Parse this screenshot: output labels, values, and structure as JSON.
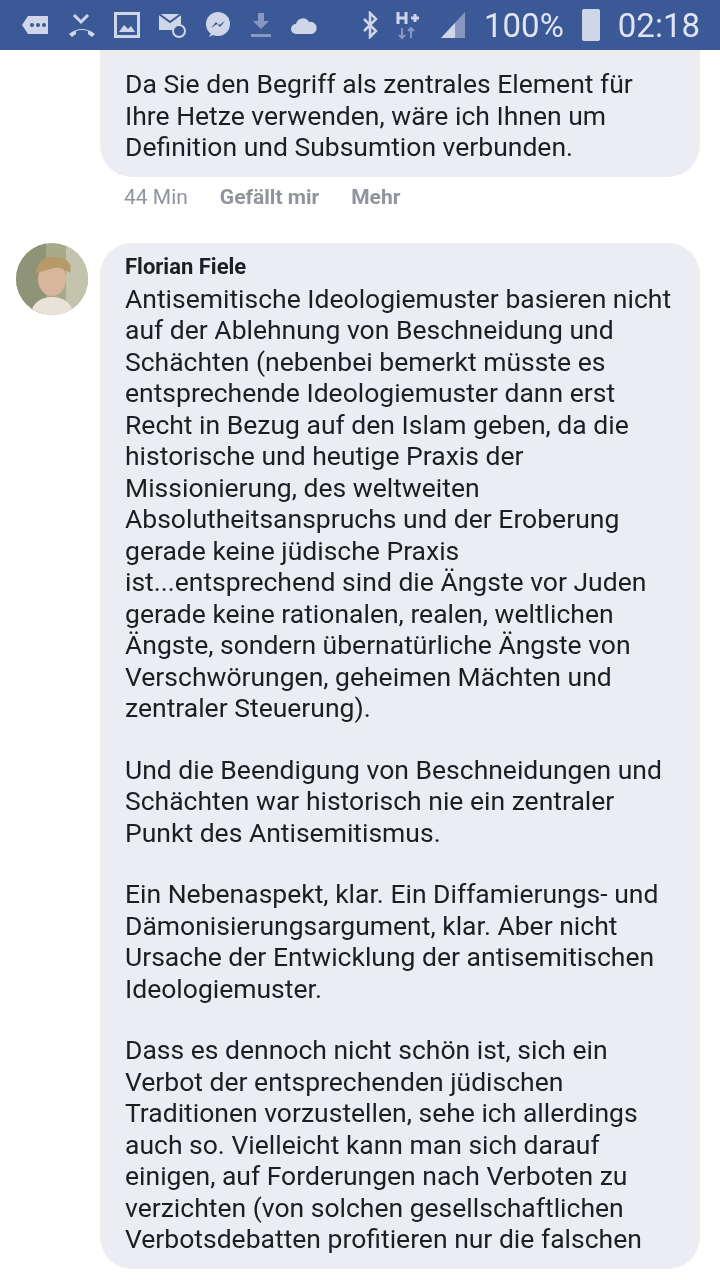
{
  "status_bar": {
    "battery": "100%",
    "time": "02:18"
  },
  "comments": [
    {
      "paragraphs": [
        "Da Sie den Begriff als zentrales Element für Ihre Hetze verwenden, wäre ich Ihnen um Definition und Subsumtion verbunden."
      ],
      "actions": {
        "time": "44 Min",
        "like": "Gefällt mir",
        "more": "Mehr"
      }
    },
    {
      "author": "Florian Fiele",
      "paragraphs": [
        "Antisemitische Ideologiemuster basieren nicht auf der Ablehnung von Beschneidung und Schächten (nebenbei bemerkt müsste es entsprechende Ideologiemuster dann erst Recht in Bezug auf den Islam geben, da die historische und heutige Praxis der Missionierung, des weltweiten Absolutheitsanspruchs und der Eroberung gerade keine jüdische Praxis ist...entsprechend sind die Ängste vor Juden gerade keine rationalen, realen, weltlichen Ängste, sondern übernatürliche Ängste von Verschwörungen, geheimen Mächten und zentraler Steuerung).",
        "Und die Beendigung von Beschneidungen und Schächten war historisch nie ein zentraler Punkt des Antisemitismus.",
        "Ein Nebenaspekt, klar. Ein Diffamierungs- und Dämonisierungsargument, klar. Aber nicht Ursache der Entwicklung der antisemitischen Ideologiemuster.",
        "Dass es dennoch nicht schön ist, sich ein Verbot der entsprechenden jüdischen Traditionen vorzustellen, sehe ich allerdings auch so. Vielleicht kann man sich darauf einigen, auf Forderungen nach Verboten zu verzichten (von solchen gesellschaftlichen Verbotsdebatten profitieren nur die falschen"
      ]
    }
  ]
}
